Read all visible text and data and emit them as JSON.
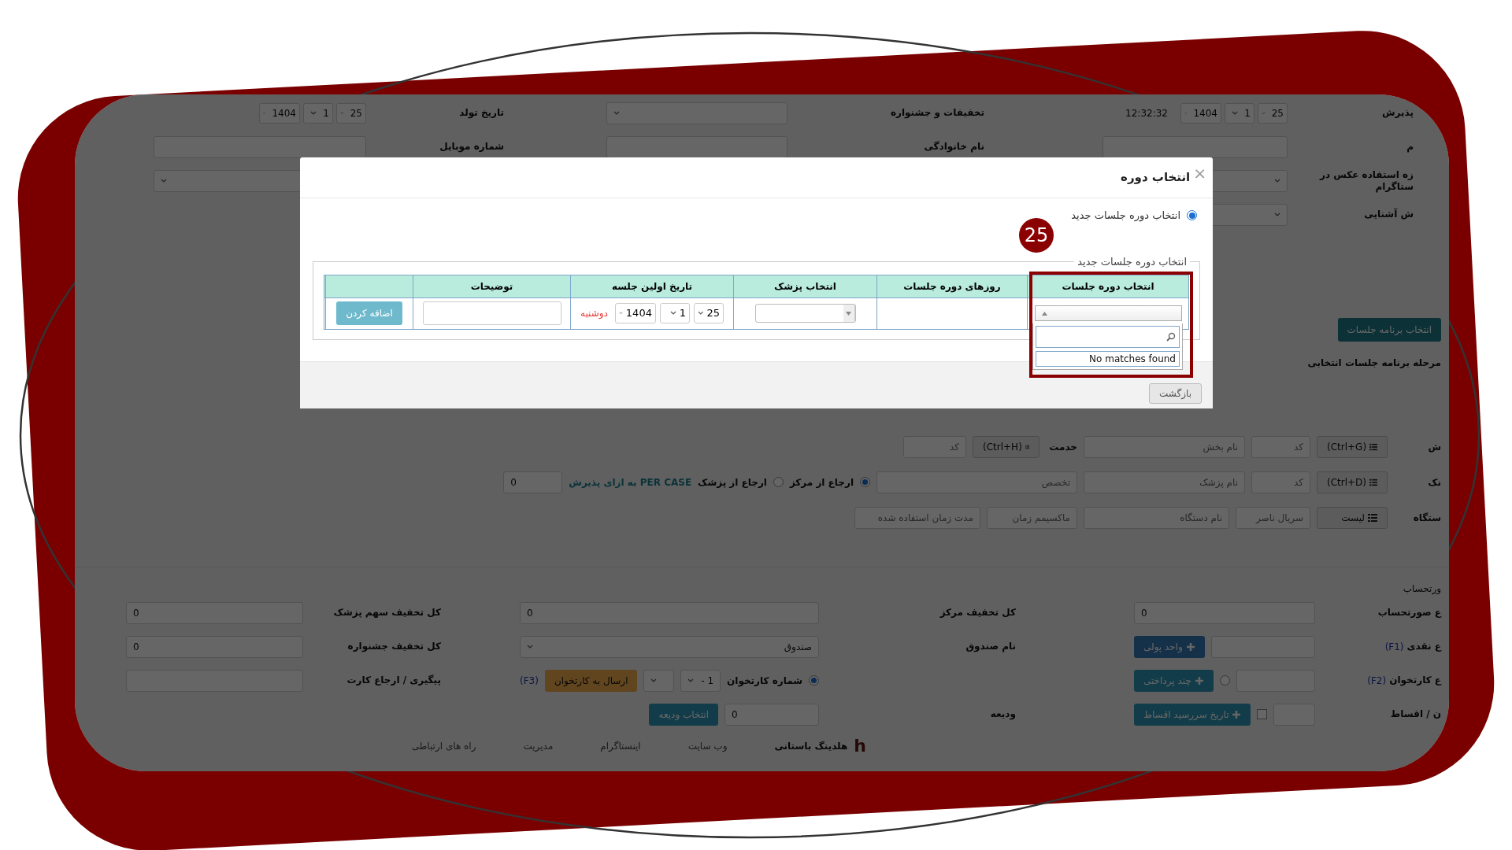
{
  "background_form": {
    "top_rows": [
      {
        "groups": [
          {
            "label": "پذیرش",
            "controls": [
              {
                "kind": "date",
                "parts": [
                  "25",
                  "1",
                  "1404"
                ]
              },
              {
                "kind": "text",
                "text": "12:32:32"
              }
            ]
          },
          {
            "label": "تخفیفات و جشنواره",
            "controls": [
              {
                "kind": "select"
              }
            ]
          },
          {
            "label": "تاریخ تولد",
            "controls": [
              {
                "kind": "date",
                "parts": [
                  "25",
                  "1",
                  "1404"
                ]
              }
            ]
          }
        ]
      },
      {
        "groups": [
          {
            "label": "م",
            "controls": [
              {
                "kind": "input"
              }
            ]
          },
          {
            "label": "نام خانوادگی",
            "controls": [
              {
                "kind": "input"
              }
            ]
          },
          {
            "label": "شماره موبایل",
            "controls": [
              {
                "kind": "input"
              }
            ]
          }
        ]
      },
      {
        "groups": [
          {
            "label": "زه استفاده عکس در ستاگرام",
            "controls": [
              {
                "kind": "select"
              }
            ]
          },
          {
            "controls": [
              {
                "kind": "select"
              }
            ]
          }
        ]
      },
      {
        "groups": [
          {
            "label": "ش آشنایی",
            "controls": [
              {
                "kind": "select"
              }
            ]
          }
        ]
      }
    ],
    "schedule": {
      "button": "انتخاب برنامه جلسات",
      "label": "مرحله برنامه جلسات انتخابی"
    },
    "middle_rows": [
      [
        {
          "kind": "label",
          "text": "ش"
        },
        {
          "kind": "button",
          "label": "(Ctrl+G)"
        },
        {
          "kind": "input",
          "placeholder": "کد"
        },
        {
          "kind": "input",
          "placeholder": "نام بخش"
        },
        {
          "kind": "label",
          "text": "خدمت"
        },
        {
          "kind": "button",
          "label": "(Ctrl+H)"
        },
        {
          "kind": "input",
          "placeholder": "کد"
        }
      ],
      [
        {
          "kind": "label",
          "text": "نک"
        },
        {
          "kind": "button",
          "label": "(Ctrl+D)"
        },
        {
          "kind": "input",
          "placeholder": "کد"
        },
        {
          "kind": "input",
          "placeholder": "نام پزشک"
        },
        {
          "kind": "input",
          "placeholder": "تخصص"
        },
        {
          "kind": "radio",
          "label": "ارجاع از مرکز",
          "selected": true
        },
        {
          "kind": "radio",
          "label": "ارجاع از پزشک",
          "selected": false
        },
        {
          "kind": "note",
          "text": "PER CASE به ازای پذیرش"
        },
        {
          "kind": "input",
          "value": "0"
        }
      ],
      [
        {
          "kind": "label",
          "text": "ستگاه"
        },
        {
          "kind": "button",
          "label": "لیست"
        },
        {
          "kind": "input",
          "placeholder": "سریال ناصر"
        },
        {
          "kind": "input",
          "placeholder": "نام دستگاه"
        },
        {
          "kind": "input",
          "placeholder": "ماکسیمم زمان"
        },
        {
          "kind": "input",
          "placeholder": "مدت زمان استفاده شده"
        }
      ]
    ],
    "invoice_title": "ورتحساب",
    "bottom_rows": [
      {
        "groups": [
          {
            "label": "ع صورتحساب",
            "controls": [
              {
                "kind": "input",
                "value": "0"
              }
            ]
          },
          {
            "label": "کل تخفیف مرکز",
            "controls": [
              {
                "kind": "input",
                "value": "0"
              }
            ]
          },
          {
            "label": "کل تخفیف سهم پزشک",
            "controls": [
              {
                "kind": "input",
                "value": "0"
              }
            ]
          }
        ]
      },
      {
        "groups": [
          {
            "label": "ع نقدی",
            "hotkey": "(F1)",
            "controls": [
              {
                "kind": "input"
              },
              {
                "kind": "button",
                "label": "واحد پولی"
              }
            ]
          },
          {
            "label": "نام صندوق",
            "controls": [
              {
                "kind": "select",
                "value": "صندوق"
              }
            ]
          },
          {
            "label": "کل تخفیف جشنواره",
            "controls": [
              {
                "kind": "input",
                "value": "0"
              }
            ]
          }
        ]
      },
      {
        "groups": [
          {
            "label": "ع کارتخوان",
            "hotkey": "(F2)",
            "controls": [
              {
                "kind": "input"
              },
              {
                "kind": "radio",
                "selected": false
              },
              {
                "kind": "button",
                "label": "چند پرداختی"
              }
            ]
          },
          {
            "controls": [
              {
                "kind": "radio",
                "label": "شماره کارتخوان",
                "selected": true
              },
              {
                "kind": "select",
                "value": "1 -"
              },
              {
                "kind": "select"
              },
              {
                "kind": "button",
                "label": "ارسال به کارتخوان"
              },
              {
                "kind": "hotkey",
                "text": "(F3)"
              }
            ]
          },
          {
            "label": "پیگیری / ارجاع کارت",
            "controls": [
              {
                "kind": "input"
              }
            ]
          }
        ]
      },
      {
        "groups": [
          {
            "label": "ن / اقساط",
            "controls": [
              {
                "kind": "input"
              },
              {
                "kind": "checkbox",
                "checked": false
              },
              {
                "kind": "button",
                "label": "تاریخ سررسید اقساط"
              }
            ]
          },
          {
            "label": "ودیعه",
            "controls": [
              {
                "kind": "input",
                "value": "0"
              },
              {
                "kind": "button",
                "label": "انتخاب ودیعه"
              }
            ]
          }
        ]
      }
    ],
    "footer": {
      "logo": "h",
      "company": "هلدینگ باستانی",
      "links": [
        "وب سایت",
        "اینستاگرام",
        "مدیریت",
        "راه های ارتباطی"
      ]
    }
  },
  "modal": {
    "title": "انتخاب دوره",
    "close": "×",
    "radio": {
      "label": "انتخاب دوره جلسات جدید",
      "selected": true
    },
    "legend": "انتخاب دوره جلسات جدید",
    "step_badge": "25",
    "table": {
      "columns": [
        "انتخاب دوره جلسات",
        "روزهای دوره جلسات",
        "انتخاب پزشک",
        "تاریخ اولین جلسه",
        "توضیحات"
      ],
      "row": {
        "period_dropdown": {
          "expanded": true,
          "message": "No matches found"
        },
        "date_parts": [
          "25",
          "1",
          "1404"
        ],
        "weekday": "دوشنبه",
        "add_button": "اضافه کردن"
      }
    },
    "back_button": "بازگشت"
  }
}
